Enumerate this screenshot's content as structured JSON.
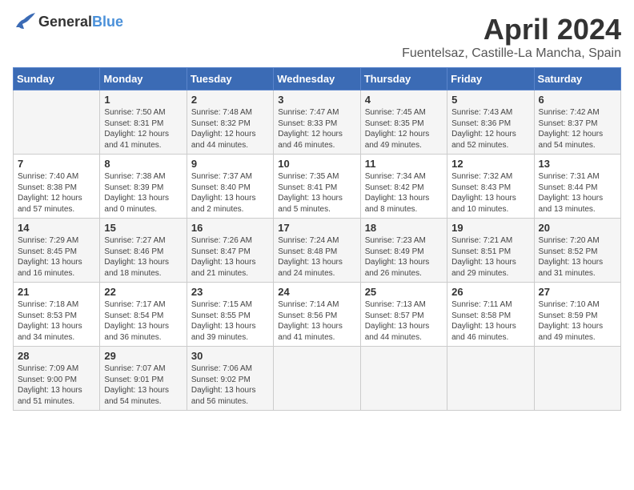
{
  "header": {
    "logo_general": "General",
    "logo_blue": "Blue",
    "month_title": "April 2024",
    "location": "Fuentelsaz, Castille-La Mancha, Spain"
  },
  "days_of_week": [
    "Sunday",
    "Monday",
    "Tuesday",
    "Wednesday",
    "Thursday",
    "Friday",
    "Saturday"
  ],
  "weeks": [
    [
      {
        "day": "",
        "content": ""
      },
      {
        "day": "1",
        "content": "Sunrise: 7:50 AM\nSunset: 8:31 PM\nDaylight: 12 hours\nand 41 minutes."
      },
      {
        "day": "2",
        "content": "Sunrise: 7:48 AM\nSunset: 8:32 PM\nDaylight: 12 hours\nand 44 minutes."
      },
      {
        "day": "3",
        "content": "Sunrise: 7:47 AM\nSunset: 8:33 PM\nDaylight: 12 hours\nand 46 minutes."
      },
      {
        "day": "4",
        "content": "Sunrise: 7:45 AM\nSunset: 8:35 PM\nDaylight: 12 hours\nand 49 minutes."
      },
      {
        "day": "5",
        "content": "Sunrise: 7:43 AM\nSunset: 8:36 PM\nDaylight: 12 hours\nand 52 minutes."
      },
      {
        "day": "6",
        "content": "Sunrise: 7:42 AM\nSunset: 8:37 PM\nDaylight: 12 hours\nand 54 minutes."
      }
    ],
    [
      {
        "day": "7",
        "content": "Sunrise: 7:40 AM\nSunset: 8:38 PM\nDaylight: 12 hours\nand 57 minutes."
      },
      {
        "day": "8",
        "content": "Sunrise: 7:38 AM\nSunset: 8:39 PM\nDaylight: 13 hours\nand 0 minutes."
      },
      {
        "day": "9",
        "content": "Sunrise: 7:37 AM\nSunset: 8:40 PM\nDaylight: 13 hours\nand 2 minutes."
      },
      {
        "day": "10",
        "content": "Sunrise: 7:35 AM\nSunset: 8:41 PM\nDaylight: 13 hours\nand 5 minutes."
      },
      {
        "day": "11",
        "content": "Sunrise: 7:34 AM\nSunset: 8:42 PM\nDaylight: 13 hours\nand 8 minutes."
      },
      {
        "day": "12",
        "content": "Sunrise: 7:32 AM\nSunset: 8:43 PM\nDaylight: 13 hours\nand 10 minutes."
      },
      {
        "day": "13",
        "content": "Sunrise: 7:31 AM\nSunset: 8:44 PM\nDaylight: 13 hours\nand 13 minutes."
      }
    ],
    [
      {
        "day": "14",
        "content": "Sunrise: 7:29 AM\nSunset: 8:45 PM\nDaylight: 13 hours\nand 16 minutes."
      },
      {
        "day": "15",
        "content": "Sunrise: 7:27 AM\nSunset: 8:46 PM\nDaylight: 13 hours\nand 18 minutes."
      },
      {
        "day": "16",
        "content": "Sunrise: 7:26 AM\nSunset: 8:47 PM\nDaylight: 13 hours\nand 21 minutes."
      },
      {
        "day": "17",
        "content": "Sunrise: 7:24 AM\nSunset: 8:48 PM\nDaylight: 13 hours\nand 24 minutes."
      },
      {
        "day": "18",
        "content": "Sunrise: 7:23 AM\nSunset: 8:49 PM\nDaylight: 13 hours\nand 26 minutes."
      },
      {
        "day": "19",
        "content": "Sunrise: 7:21 AM\nSunset: 8:51 PM\nDaylight: 13 hours\nand 29 minutes."
      },
      {
        "day": "20",
        "content": "Sunrise: 7:20 AM\nSunset: 8:52 PM\nDaylight: 13 hours\nand 31 minutes."
      }
    ],
    [
      {
        "day": "21",
        "content": "Sunrise: 7:18 AM\nSunset: 8:53 PM\nDaylight: 13 hours\nand 34 minutes."
      },
      {
        "day": "22",
        "content": "Sunrise: 7:17 AM\nSunset: 8:54 PM\nDaylight: 13 hours\nand 36 minutes."
      },
      {
        "day": "23",
        "content": "Sunrise: 7:15 AM\nSunset: 8:55 PM\nDaylight: 13 hours\nand 39 minutes."
      },
      {
        "day": "24",
        "content": "Sunrise: 7:14 AM\nSunset: 8:56 PM\nDaylight: 13 hours\nand 41 minutes."
      },
      {
        "day": "25",
        "content": "Sunrise: 7:13 AM\nSunset: 8:57 PM\nDaylight: 13 hours\nand 44 minutes."
      },
      {
        "day": "26",
        "content": "Sunrise: 7:11 AM\nSunset: 8:58 PM\nDaylight: 13 hours\nand 46 minutes."
      },
      {
        "day": "27",
        "content": "Sunrise: 7:10 AM\nSunset: 8:59 PM\nDaylight: 13 hours\nand 49 minutes."
      }
    ],
    [
      {
        "day": "28",
        "content": "Sunrise: 7:09 AM\nSunset: 9:00 PM\nDaylight: 13 hours\nand 51 minutes."
      },
      {
        "day": "29",
        "content": "Sunrise: 7:07 AM\nSunset: 9:01 PM\nDaylight: 13 hours\nand 54 minutes."
      },
      {
        "day": "30",
        "content": "Sunrise: 7:06 AM\nSunset: 9:02 PM\nDaylight: 13 hours\nand 56 minutes."
      },
      {
        "day": "",
        "content": ""
      },
      {
        "day": "",
        "content": ""
      },
      {
        "day": "",
        "content": ""
      },
      {
        "day": "",
        "content": ""
      }
    ]
  ]
}
